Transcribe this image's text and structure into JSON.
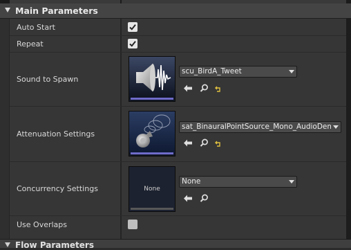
{
  "section": {
    "title": "Main Parameters"
  },
  "next_section": {
    "title": "Flow Parameters"
  },
  "rows": {
    "auto_start": {
      "label": "Auto Start",
      "checked": true
    },
    "repeat": {
      "label": "Repeat",
      "checked": true
    },
    "sound": {
      "label": "Sound to Spawn",
      "value": "scu_BirdA_Tweet",
      "thumbnail_icon": "speaker-waveform-icon"
    },
    "attenuation": {
      "label": "Attenuation Settings",
      "value": "sat_BinauralPointSource_Mono_AudioDemo",
      "thumbnail_icon": "speaker-attenuation-cone-icon"
    },
    "concurrency": {
      "label": "Concurrency Settings",
      "value": "None",
      "thumbnail_text": "None"
    },
    "overlaps": {
      "label": "Use Overlaps",
      "checked": false
    }
  },
  "colors": {
    "asset_bar": "#6e6bc9",
    "reset_arrow": "#e0c040"
  }
}
